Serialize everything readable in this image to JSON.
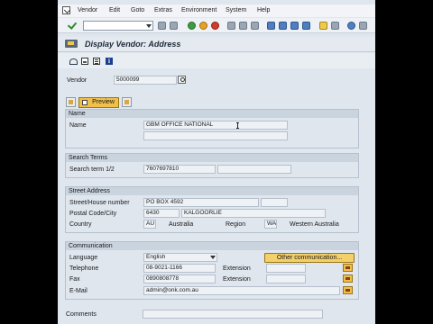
{
  "menu": {
    "items": [
      "Vendor",
      "Edit",
      "Goto",
      "Extras",
      "Environment",
      "System",
      "Help"
    ]
  },
  "icons": {
    "app": "sap-app-icon",
    "enter": "check-icon",
    "save": "save-icon",
    "back": "back-icon",
    "exit": "exit-icon",
    "cancel": "cancel-icon",
    "print": "print-icon",
    "find": "find-icon",
    "layout": "layout-icon",
    "help": "help-icon",
    "display_change": "glasses-icon",
    "info": "info-icon"
  },
  "title": "Display Vendor: Address",
  "vendor": {
    "label": "Vendor",
    "value": "5000099"
  },
  "preview_button": "Preview",
  "name_group": {
    "header": "Name",
    "name_label": "Name",
    "name_value": "GBM OFFICE NATIONAL",
    "name2_value": ""
  },
  "search_terms_group": {
    "header": "Search Terms",
    "label": "Search term 1/2",
    "term1": "7607697810",
    "term2": ""
  },
  "street_group": {
    "header": "Street Address",
    "street_label": "Street/House number",
    "street_value": "PO BOX 4592",
    "house_value": "",
    "postal_label": "Postal Code/City",
    "postal_value": "6430",
    "city_value": "KALGOORLIE",
    "country_label": "Country",
    "country_code": "AU",
    "country_name": "Australia",
    "region_label": "Region",
    "region_code": "WA",
    "region_name": "Western Australia"
  },
  "communication_group": {
    "header": "Communication",
    "language_label": "Language",
    "language_value": "English",
    "other_button": "Other communication...",
    "telephone_label": "Telephone",
    "telephone_value": "08-9021-1166",
    "tel_ext_label": "Extension",
    "tel_ext_value": "",
    "fax_label": "Fax",
    "fax_value": "0890808778",
    "fax_ext_label": "Extension",
    "fax_ext_value": "",
    "email_label": "E-Mail",
    "email_value": "admin@onk.com.au"
  },
  "comments": {
    "label": "Comments",
    "value": ""
  },
  "colors": {
    "background": "#dfe6ee",
    "group_header": "#cad4df",
    "button_yellow": "#f0c04a"
  }
}
